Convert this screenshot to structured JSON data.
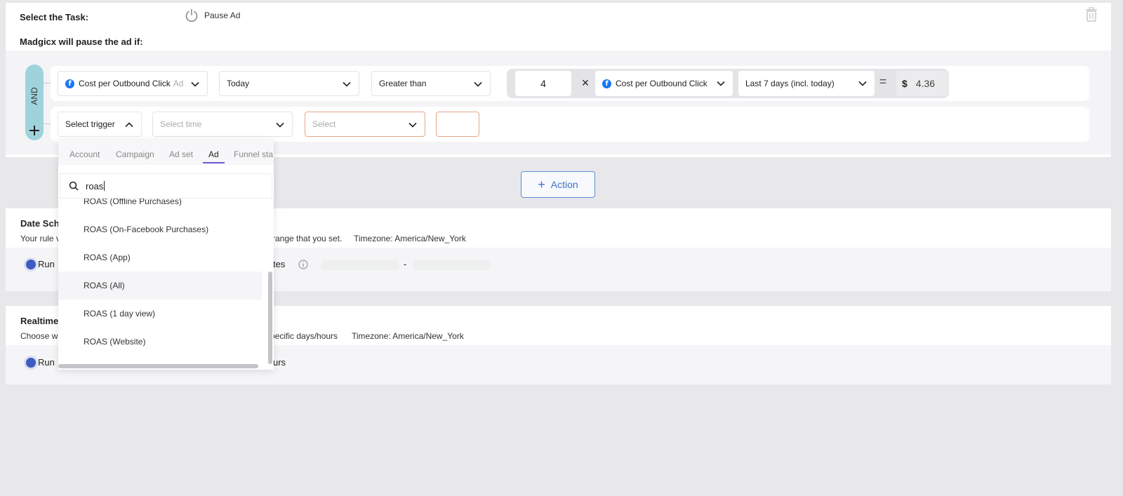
{
  "task": {
    "select_label": "Select the Task:",
    "pause_ad_label": "Pause Ad",
    "pause_if_label": "Madgicx will pause the ad if:"
  },
  "rule": {
    "logic_label": "AND",
    "row1": {
      "metric": "Cost per Outbound Click",
      "metric_level": "Ad",
      "time": "Today",
      "operator": "Greater than",
      "multiplier": "4",
      "compare_metric": "Cost per Outbound Click",
      "compare_time": "Last 7 days (incl. today)",
      "currency": "$",
      "result": "4.36"
    },
    "row2": {
      "trigger": "Select trigger",
      "time_placeholder": "Select time",
      "operator_placeholder": "Select",
      "value": ""
    }
  },
  "dropdown": {
    "tabs": [
      "Account",
      "Campaign",
      "Ad set",
      "Ad",
      "Funnel sta"
    ],
    "active_tab": "Ad",
    "search_value": "roas",
    "items": [
      "ROAS (Offline Purchases)",
      "ROAS (On-Facebook Purchases)",
      "ROAS (App)",
      "ROAS (All)",
      "ROAS (1 day view)",
      "ROAS (Website)"
    ]
  },
  "action_button": {
    "label": "Action"
  },
  "date_schedule": {
    "title": "Date Sch",
    "desc_start": "Your rule v",
    "desc_end": "range that you set.",
    "timezone": "Timezone: America/New_York",
    "radio_label": "Run",
    "dates_label": "tes",
    "dash": "-"
  },
  "realtime": {
    "title": "Realtime",
    "desc_start": "Choose w",
    "desc_end": "pecific days/hours",
    "timezone": "Timezone: America/New_York",
    "radio_label": "Run",
    "hours_label": "urs"
  },
  "colors": {
    "and_pill": "#9fd3dc",
    "accent": "#3f74c6",
    "radio": "#3f5bbd",
    "error_border": "#e3a78c",
    "tab_underline": "#6c5ad6",
    "facebook": "#1877f2"
  }
}
